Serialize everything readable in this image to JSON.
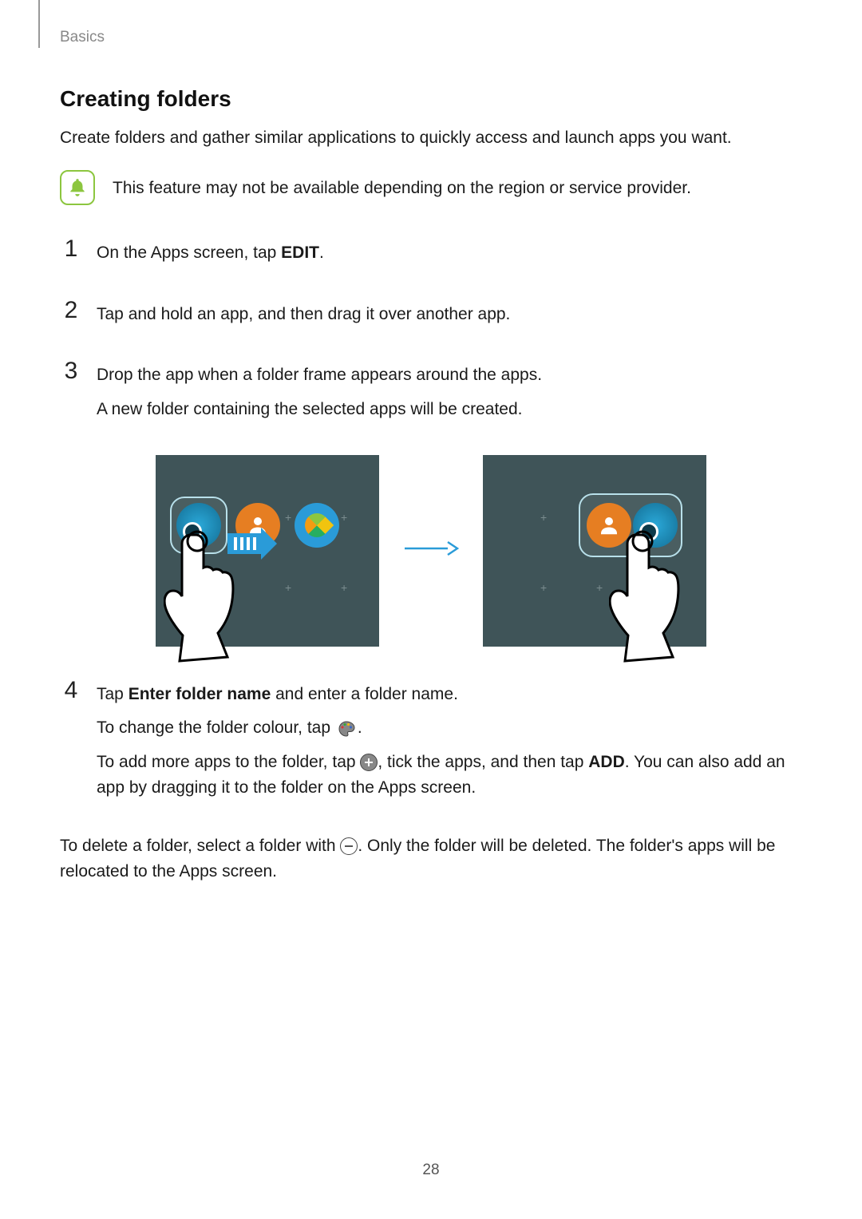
{
  "breadcrumb": "Basics",
  "title": "Creating folders",
  "intro": "Create folders and gather similar applications to quickly access and launch apps you want.",
  "note": "This feature may not be available depending on the region or service provider.",
  "steps": {
    "s1_num": "1",
    "s1_a": "On the Apps screen, tap ",
    "s1_b": "EDIT",
    "s1_c": ".",
    "s2_num": "2",
    "s2": "Tap and hold an app, and then drag it over another app.",
    "s3_num": "3",
    "s3_a": "Drop the app when a folder frame appears around the apps.",
    "s3_b": "A new folder containing the selected apps will be created.",
    "s4_num": "4",
    "s4_a1": "Tap ",
    "s4_a2": "Enter folder name",
    "s4_a3": " and enter a folder name.",
    "s4_b": "To change the folder colour, tap ",
    "s4_b_end": ".",
    "s4_c1": "To add more apps to the folder, tap ",
    "s4_c2": ", tick the apps, and then tap ",
    "s4_c3": "ADD",
    "s4_c4": ". You can also add an app by dragging it to the folder on the Apps screen."
  },
  "closing_a": "To delete a folder, select a folder with ",
  "closing_b": ". Only the folder will be deleted. The folder's apps will be relocated to the Apps screen.",
  "page_number": "28",
  "icons": {
    "note": "bell-icon",
    "palette": "palette-icon",
    "plus": "plus-circle-icon",
    "minus": "minus-circle-icon",
    "arrow": "arrow-right-icon"
  }
}
